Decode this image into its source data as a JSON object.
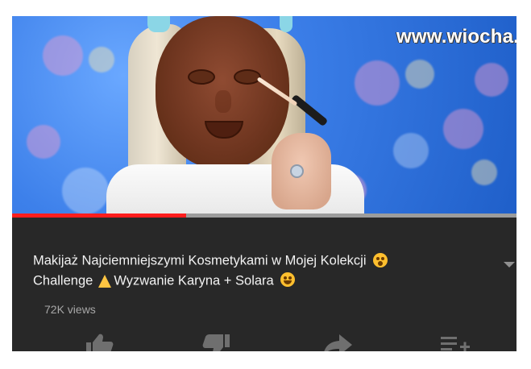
{
  "watermark": "www.wiocha.pl",
  "video": {
    "title_line_1": "Makijaż Najciemniejszymi Kosmetykami w Mojej Kolekcji",
    "title_line_2_a": "Challenge",
    "title_line_2_b": "Wyzwanie Karyna + Solara",
    "views": "72K views",
    "progress_fraction": 0.345
  },
  "icons": {
    "like": "thumbs-up-icon",
    "dislike": "thumbs-down-icon",
    "share": "share-icon",
    "save": "add-to-playlist-icon",
    "menu": "chevron-down-icon"
  },
  "colors": {
    "video_background": "#3d80ea",
    "panel_background": "#282828",
    "title_text": "#f2f2f2",
    "views_text": "#a7a7a7",
    "progress": "#ff1e1e",
    "action_icons": "#6f6f6f"
  }
}
